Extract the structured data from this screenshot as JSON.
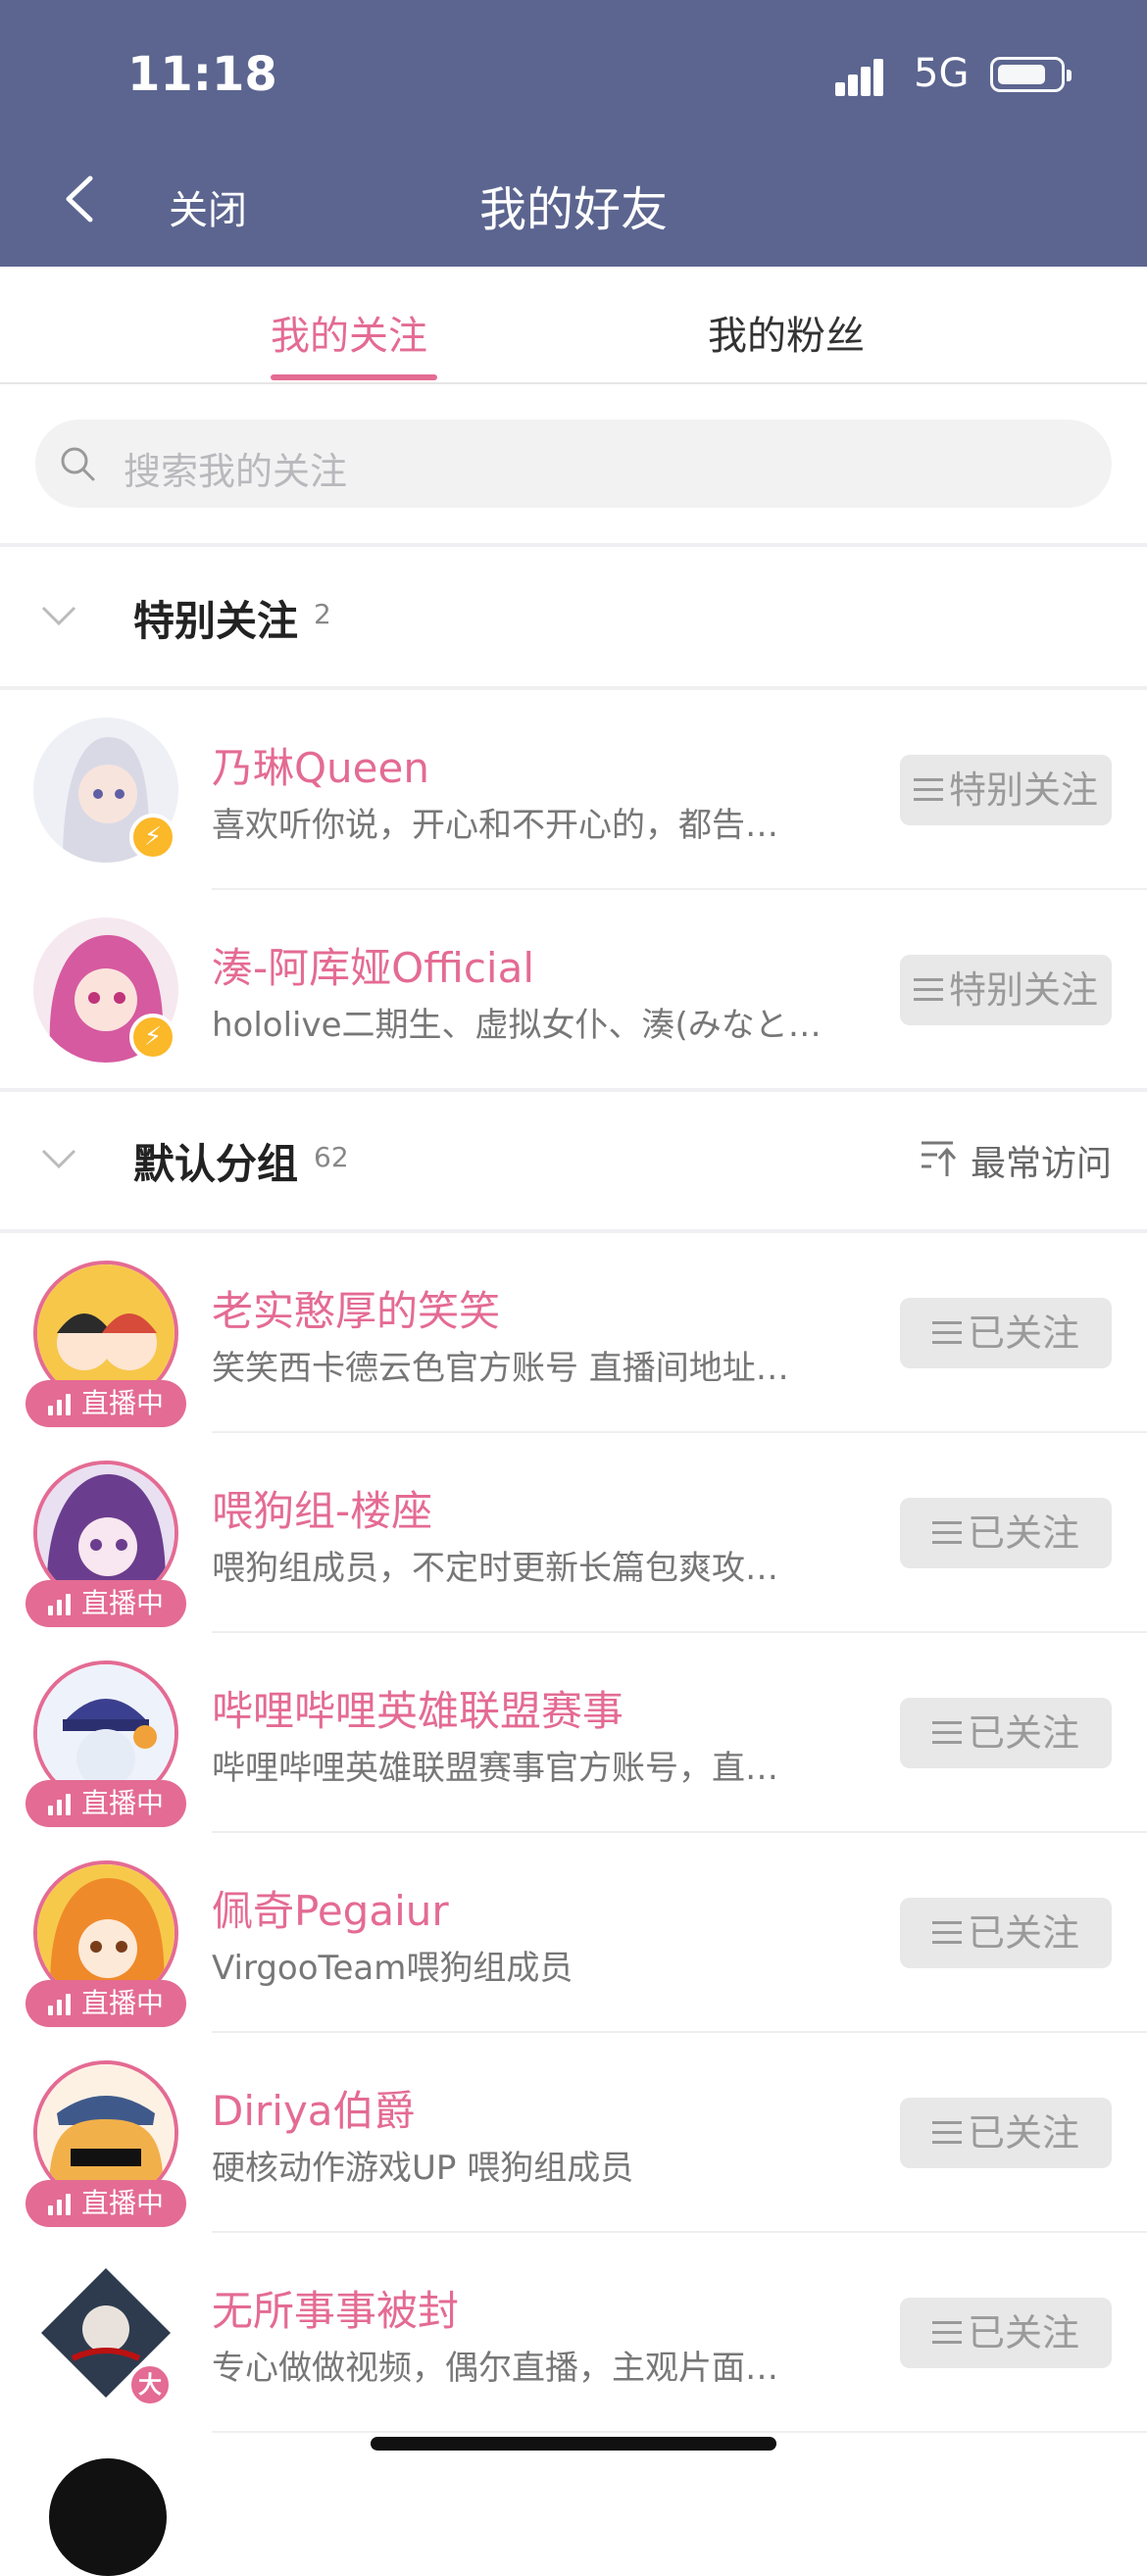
{
  "status_bar": {
    "time": "11:18",
    "network": "5G"
  },
  "header": {
    "close_label": "关闭",
    "title": "我的好友"
  },
  "tabs": [
    {
      "label": "我的关注",
      "active": true
    },
    {
      "label": "我的粉丝",
      "active": false
    }
  ],
  "search": {
    "placeholder": "搜索我的关注"
  },
  "special_group": {
    "name": "特别关注",
    "count": "2",
    "users": [
      {
        "name": "乃琳Queen",
        "desc": "喜欢听你说，开心和不开心的，都告…",
        "button": "特别关注"
      },
      {
        "name": "湊-阿库娅Official",
        "desc": "hololive二期生、虚拟女仆、湊(みなと…",
        "button": "特别关注"
      }
    ]
  },
  "default_group": {
    "name": "默认分组",
    "count": "62",
    "sort_label": "最常访问",
    "live_label": "直播中",
    "users": [
      {
        "name": "老实憨厚的笑笑",
        "desc": "笑笑西卡德云色官方账号 直播间地址…",
        "button": "已关注",
        "live": true
      },
      {
        "name": "喂狗组-楼座",
        "desc": "喂狗组成员，不定时更新长篇包爽攻…",
        "button": "已关注",
        "live": true
      },
      {
        "name": "哔哩哔哩英雄联盟赛事",
        "desc": "哔哩哔哩英雄联盟赛事官方账号，直…",
        "button": "已关注",
        "live": true
      },
      {
        "name": "佩奇Pegaiur",
        "desc": "VirgooTeam喂狗组成员",
        "button": "已关注",
        "live": true
      },
      {
        "name": "Diriya伯爵",
        "desc": "硬核动作游戏UP 喂狗组成员",
        "button": "已关注",
        "live": true
      },
      {
        "name": "无所事事被封",
        "desc": "专心做做视频，偶尔直播，主观片面…",
        "button": "已关注",
        "live": false,
        "badge": "大"
      }
    ]
  },
  "colors": {
    "header_bg": "#5b658f",
    "accent_pink": "#e46b93",
    "bolt_yellow": "#fbb829"
  }
}
